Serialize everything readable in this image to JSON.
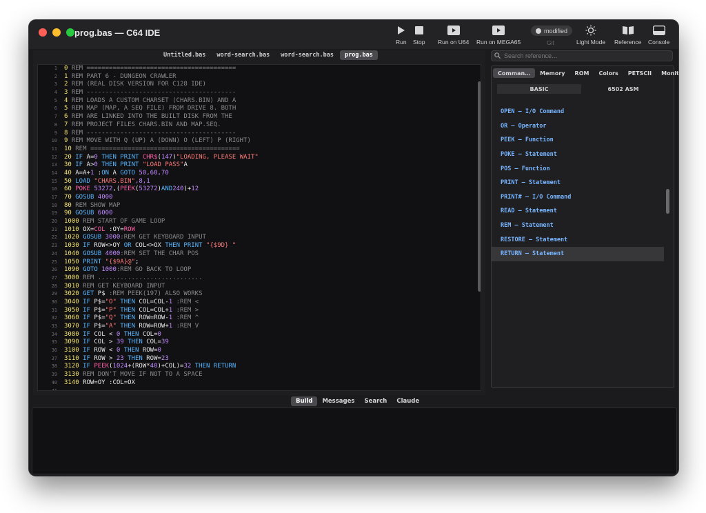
{
  "window": {
    "title": "prog.bas — C64 IDE",
    "light_colors": [
      "#fe5f57",
      "#febc2e",
      "#28c840"
    ]
  },
  "toolbar": {
    "run": "Run",
    "stop": "Stop",
    "run_u64": "Run on U64",
    "run_mega65": "Run on MEGA65",
    "modified": "modified",
    "git": "Git",
    "light_mode": "Light Mode",
    "reference": "Reference",
    "console": "Console"
  },
  "editor": {
    "tabs": [
      "Untitled.bas",
      "word-search.bas",
      "word-search.bas",
      "prog.bas"
    ],
    "active_tab": 3,
    "colors": {
      "num": "#f3e26e",
      "kw": "#57b6ff",
      "fn": "#ff5fa8",
      "str": "#ff7a7a",
      "rem": "#8a8a8e",
      "val": "#c08bff",
      "plain": "#e6e6e6"
    },
    "lines": [
      [
        [
          "num",
          "0 "
        ],
        [
          "rem",
          "REM ========================================"
        ]
      ],
      [
        [
          "num",
          "1 "
        ],
        [
          "rem",
          "REM PART 6 - DUNGEON CRAWLER"
        ]
      ],
      [
        [
          "num",
          "2 "
        ],
        [
          "rem",
          "REM (REAL DISK VERSION FOR C128 IDE)"
        ]
      ],
      [
        [
          "num",
          "3 "
        ],
        [
          "rem",
          "REM ----------------------------------------"
        ]
      ],
      [
        [
          "num",
          "4 "
        ],
        [
          "rem",
          "REM LOADS A CUSTOM CHARSET (CHARS.BIN) AND A"
        ]
      ],
      [
        [
          "num",
          "5 "
        ],
        [
          "rem",
          "REM MAP (MAP, A SEQ FILE) FROM DRIVE 8. BOTH"
        ]
      ],
      [
        [
          "num",
          "6 "
        ],
        [
          "rem",
          "REM ARE LINKED INTO THE BUILT DISK FROM THE"
        ]
      ],
      [
        [
          "num",
          "7 "
        ],
        [
          "rem",
          "REM PROJECT FILES CHARS.BIN AND MAP.SEQ."
        ]
      ],
      [
        [
          "num",
          "8 "
        ],
        [
          "rem",
          "REM ----------------------------------------"
        ]
      ],
      [
        [
          "num",
          "9 "
        ],
        [
          "rem",
          "REM MOVE WITH Q (UP) A (DOWN) O (LEFT) P (RIGHT)"
        ]
      ],
      [
        [
          "num",
          "10 "
        ],
        [
          "rem",
          "REM ========================================"
        ]
      ],
      [
        [
          "num",
          "20 "
        ],
        [
          "kw",
          "IF "
        ],
        [
          "plain",
          "A="
        ],
        [
          "val",
          "0"
        ],
        [
          "kw",
          " THEN PRINT "
        ],
        [
          "fn",
          "CHR$"
        ],
        [
          "plain",
          "("
        ],
        [
          "val",
          "147"
        ],
        [
          "plain",
          ")"
        ],
        [
          "str",
          "\"LOADING, PLEASE WAIT\""
        ]
      ],
      [
        [
          "num",
          "30 "
        ],
        [
          "kw",
          "IF "
        ],
        [
          "plain",
          "A>"
        ],
        [
          "val",
          "0"
        ],
        [
          "kw",
          " THEN PRINT "
        ],
        [
          "str",
          "\"LOAD PASS\""
        ],
        [
          "plain",
          "A"
        ]
      ],
      [
        [
          "num",
          "40 "
        ],
        [
          "plain",
          "A=A+"
        ],
        [
          "val",
          "1"
        ],
        [
          "plain",
          " :"
        ],
        [
          "kw",
          "ON "
        ],
        [
          "plain",
          "A "
        ],
        [
          "kw",
          "GOTO "
        ],
        [
          "val",
          "50,60,70"
        ]
      ],
      [
        [
          "num",
          "50 "
        ],
        [
          "kw",
          "LOAD "
        ],
        [
          "str",
          "\"CHARS.BIN\""
        ],
        [
          "val",
          ",8,1"
        ]
      ],
      [
        [
          "num",
          "60 "
        ],
        [
          "fn",
          "POKE "
        ],
        [
          "val",
          "53272"
        ],
        [
          "plain",
          ",("
        ],
        [
          "fn",
          "PEEK"
        ],
        [
          "plain",
          "("
        ],
        [
          "val",
          "53272"
        ],
        [
          "plain",
          ")"
        ],
        [
          "kw",
          "AND"
        ],
        [
          "val",
          "240"
        ],
        [
          "plain",
          ")+"
        ],
        [
          "val",
          "12"
        ]
      ],
      [
        [
          "num",
          "70 "
        ],
        [
          "kw",
          "GOSUB "
        ],
        [
          "val",
          "4000"
        ]
      ],
      [
        [
          "num",
          "80 "
        ],
        [
          "rem",
          "REM SHOW MAP"
        ]
      ],
      [
        [
          "num",
          "90 "
        ],
        [
          "kw",
          "GOSUB "
        ],
        [
          "val",
          "6000"
        ]
      ],
      [
        [
          "num",
          "1000 "
        ],
        [
          "rem",
          "REM START OF GAME LOOP"
        ]
      ],
      [
        [
          "num",
          "1010 "
        ],
        [
          "plain",
          "OX="
        ],
        [
          "fn",
          "COL"
        ],
        [
          "plain",
          " :OY="
        ],
        [
          "fn",
          "ROW"
        ]
      ],
      [
        [
          "num",
          "1020 "
        ],
        [
          "kw",
          "GOSUB "
        ],
        [
          "val",
          "3000"
        ],
        [
          "rem",
          ":REM GET KEYBOARD INPUT"
        ]
      ],
      [
        [
          "num",
          "1030 "
        ],
        [
          "kw",
          "IF "
        ],
        [
          "plain",
          "ROW<>OY "
        ],
        [
          "kw",
          "OR "
        ],
        [
          "plain",
          "COL<>OX "
        ],
        [
          "kw",
          "THEN PRINT "
        ],
        [
          "str",
          "\"{$9D} \""
        ]
      ],
      [
        [
          "num",
          "1040 "
        ],
        [
          "kw",
          "GOSUB "
        ],
        [
          "val",
          "4000"
        ],
        [
          "rem",
          ":REM SET THE CHAR POS"
        ]
      ],
      [
        [
          "num",
          "1050 "
        ],
        [
          "kw",
          "PRINT "
        ],
        [
          "str",
          "\"{$9A}@\""
        ],
        [
          "plain",
          ";"
        ]
      ],
      [
        [
          "num",
          "1090 "
        ],
        [
          "kw",
          "GOTO "
        ],
        [
          "val",
          "1000"
        ],
        [
          "rem",
          ":REM GO BACK TO LOOP"
        ]
      ],
      [
        [
          "num",
          "3000 "
        ],
        [
          "rem",
          "REM ............................"
        ]
      ],
      [
        [
          "num",
          "3010 "
        ],
        [
          "rem",
          "REM GET KEYBOARD INPUT"
        ]
      ],
      [
        [
          "num",
          "3020 "
        ],
        [
          "kw",
          "GET "
        ],
        [
          "plain",
          "P$ "
        ],
        [
          "rem",
          ":REM PEEK(197) ALSO WORKS"
        ]
      ],
      [
        [
          "num",
          "3040 "
        ],
        [
          "kw",
          "IF "
        ],
        [
          "plain",
          "P$="
        ],
        [
          "str",
          "\"O\""
        ],
        [
          "kw",
          " THEN "
        ],
        [
          "plain",
          "COL=COL-"
        ],
        [
          "val",
          "1"
        ],
        [
          "rem",
          " :REM <"
        ]
      ],
      [
        [
          "num",
          "3050 "
        ],
        [
          "kw",
          "IF "
        ],
        [
          "plain",
          "P$="
        ],
        [
          "str",
          "\"P\""
        ],
        [
          "kw",
          " THEN "
        ],
        [
          "plain",
          "COL=COL+"
        ],
        [
          "val",
          "1"
        ],
        [
          "rem",
          " :REM >"
        ]
      ],
      [
        [
          "num",
          "3060 "
        ],
        [
          "kw",
          "IF "
        ],
        [
          "plain",
          "P$="
        ],
        [
          "str",
          "\"Q\""
        ],
        [
          "kw",
          " THEN "
        ],
        [
          "plain",
          "ROW=ROW-"
        ],
        [
          "val",
          "1"
        ],
        [
          "rem",
          " :REM ^"
        ]
      ],
      [
        [
          "num",
          "3070 "
        ],
        [
          "kw",
          "IF "
        ],
        [
          "plain",
          "P$="
        ],
        [
          "str",
          "\"A\""
        ],
        [
          "kw",
          " THEN "
        ],
        [
          "plain",
          "ROW=ROW+"
        ],
        [
          "val",
          "1"
        ],
        [
          "rem",
          " :REM V"
        ]
      ],
      [
        [
          "num",
          "3080 "
        ],
        [
          "kw",
          "IF "
        ],
        [
          "plain",
          "COL < "
        ],
        [
          "val",
          "0"
        ],
        [
          "kw",
          " THEN "
        ],
        [
          "plain",
          "COL="
        ],
        [
          "val",
          "0"
        ]
      ],
      [
        [
          "num",
          "3090 "
        ],
        [
          "kw",
          "IF "
        ],
        [
          "plain",
          "COL > "
        ],
        [
          "val",
          "39"
        ],
        [
          "kw",
          " THEN "
        ],
        [
          "plain",
          "COL="
        ],
        [
          "val",
          "39"
        ]
      ],
      [
        [
          "num",
          "3100 "
        ],
        [
          "kw",
          "IF "
        ],
        [
          "plain",
          "ROW < "
        ],
        [
          "val",
          "0"
        ],
        [
          "kw",
          " THEN "
        ],
        [
          "plain",
          "ROW="
        ],
        [
          "val",
          "0"
        ]
      ],
      [
        [
          "num",
          "3110 "
        ],
        [
          "kw",
          "IF "
        ],
        [
          "plain",
          "ROW > "
        ],
        [
          "val",
          "23"
        ],
        [
          "kw",
          " THEN "
        ],
        [
          "plain",
          "ROW="
        ],
        [
          "val",
          "23"
        ]
      ],
      [
        [
          "num",
          "3120 "
        ],
        [
          "kw",
          "IF "
        ],
        [
          "fn",
          "PEEK"
        ],
        [
          "plain",
          "("
        ],
        [
          "val",
          "1024"
        ],
        [
          "plain",
          "+(ROW*"
        ],
        [
          "val",
          "40"
        ],
        [
          "plain",
          ")+COL)="
        ],
        [
          "val",
          "32"
        ],
        [
          "kw",
          " THEN RETURN"
        ]
      ],
      [
        [
          "num",
          "3130 "
        ],
        [
          "rem",
          "REM DON'T MOVE IF NOT TO A SPACE"
        ]
      ],
      [
        [
          "num",
          "3140 "
        ],
        [
          "plain",
          "ROW=OY :COL=OX"
        ]
      ],
      [
        [
          "plain",
          ""
        ]
      ]
    ]
  },
  "reference": {
    "search_placeholder": "Search reference…",
    "tabs": [
      "Comman…",
      "Memory",
      "ROM",
      "Colors",
      "PETSCII",
      "Monitor"
    ],
    "active_tab": 0,
    "subtabs": [
      "BASIC",
      "6502 ASM"
    ],
    "active_subtab": 0,
    "items": [
      "OPEN — I/O Command",
      "OR — Operator",
      "PEEK — Function",
      "POKE — Statement",
      "POS — Function",
      "PRINT — Statement",
      "PRINT# — I/O Command",
      "READ — Statement",
      "REM — Statement",
      "RESTORE — Statement",
      "RETURN — Statement"
    ],
    "selected_item": 10
  },
  "bottom": {
    "tabs": [
      "Build",
      "Messages",
      "Search",
      "Claude"
    ],
    "active_tab": 0
  }
}
